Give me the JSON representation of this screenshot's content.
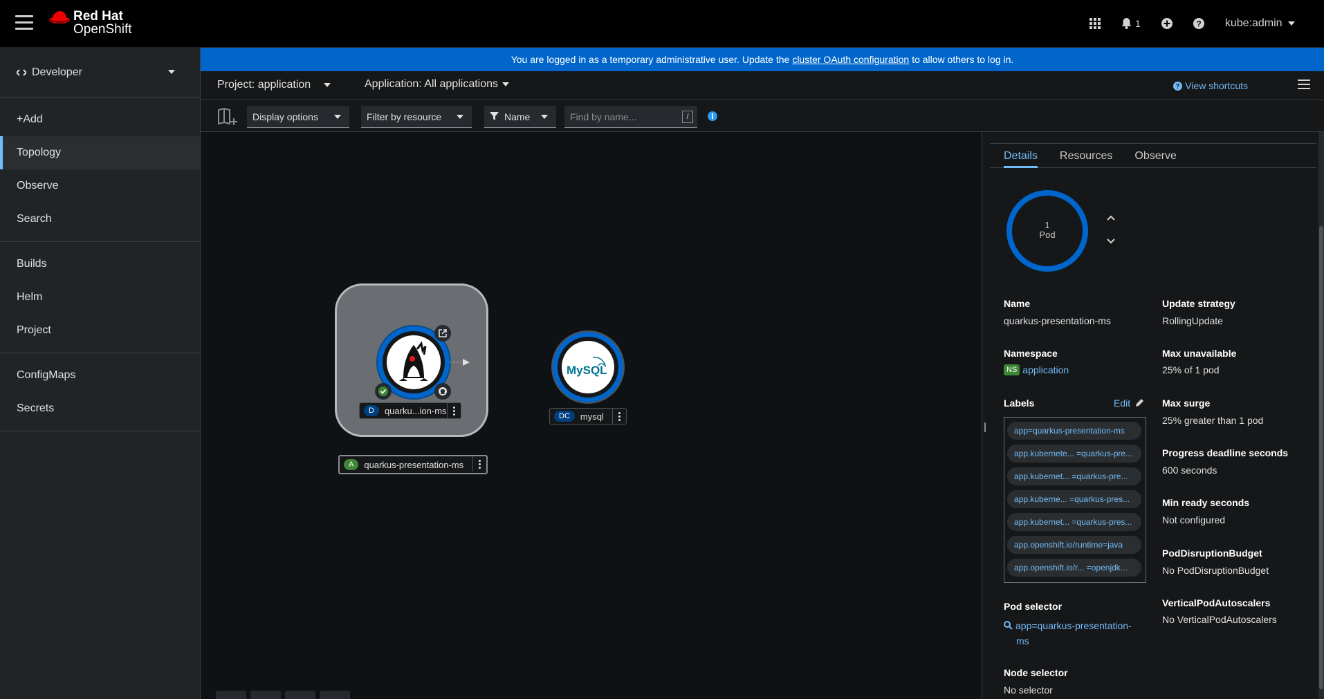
{
  "masthead": {
    "brand_line1": "Red Hat",
    "brand_line2": "OpenShift",
    "notification_count": "1",
    "user": "kube:admin"
  },
  "sidebar": {
    "perspective": "Developer",
    "groups": [
      [
        "+Add",
        "Topology",
        "Observe",
        "Search"
      ],
      [
        "Builds",
        "Helm",
        "Project"
      ],
      [
        "ConfigMaps",
        "Secrets"
      ]
    ],
    "active": "Topology"
  },
  "banner": {
    "prefix": "You are logged in as a temporary administrative user. Update the",
    "link": "cluster OAuth configuration",
    "suffix": "to allow others to log in."
  },
  "projectbar": {
    "project": "Project: application",
    "application": "Application: All applications",
    "shortcuts": "View shortcuts"
  },
  "toolbar": {
    "display_options": "Display options",
    "filter_by_resource": "Filter by resource",
    "filter_type": "Name",
    "search_placeholder": "Find by name...",
    "slash_key": "/"
  },
  "topology": {
    "app_group": {
      "badge": "A",
      "name": "quarkus-presentation-ms",
      "badge_color": "#3e8635"
    },
    "deployment": {
      "badge": "D",
      "name": "quarku...ion-ms",
      "badge_color": "#004080"
    },
    "mysql": {
      "badge": "DC",
      "name": "mysql",
      "logo_text": "MySQL",
      "badge_color": "#004080"
    }
  },
  "panel": {
    "tabs": [
      "Details",
      "Resources",
      "Observe"
    ],
    "active_tab": "Details",
    "pod_count": "1",
    "pod_label": "Pod",
    "left_fields": {
      "name_label": "Name",
      "name_value": "quarkus-presentation-ms",
      "namespace_label": "Namespace",
      "namespace_badge": "NS",
      "namespace_value": "application",
      "labels_label": "Labels",
      "labels_edit": "Edit",
      "labels": [
        "app=quarkus-presentation-ms",
        "app.kubernete... =quarkus-pre...",
        "app.kubernet... =quarkus-pre...",
        "app.kuberne... =quarkus-pres...",
        "app.kubernet... =quarkus-pres...",
        "app.openshift.io/runtime=java",
        "app.openshift.io/r... =openjdk..."
      ],
      "pod_selector_label": "Pod selector",
      "pod_selector_line1": "app=quarkus-presentation-",
      "pod_selector_line2": "ms",
      "node_selector_label": "Node selector",
      "node_selector_value": "No selector"
    },
    "right_fields": {
      "update_strategy_label": "Update strategy",
      "update_strategy_value": "RollingUpdate",
      "max_unavailable_label": "Max unavailable",
      "max_unavailable_value": "25% of 1 pod",
      "max_surge_label": "Max surge",
      "max_surge_value": "25% greater than 1 pod",
      "progress_label": "Progress deadline seconds",
      "progress_value": "600 seconds",
      "min_ready_label": "Min ready seconds",
      "min_ready_value": "Not configured",
      "pdb_label": "PodDisruptionBudget",
      "pdb_value": "No PodDisruptionBudget",
      "vpa_label": "VerticalPodAutoscalers",
      "vpa_value": "No VerticalPodAutoscalers"
    }
  },
  "colors": {
    "accent": "#0066cc",
    "link": "#73bcf7",
    "ring": "#0066cc"
  }
}
